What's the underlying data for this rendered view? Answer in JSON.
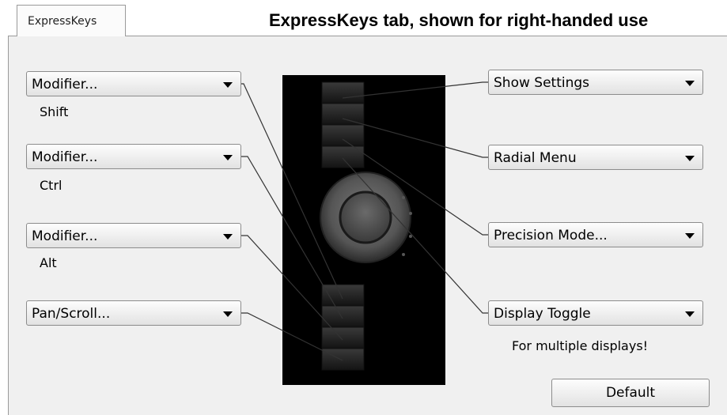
{
  "tab": {
    "label": "ExpressKeys"
  },
  "caption": "ExpressKeys tab, shown for right-handed use",
  "left_keys": [
    {
      "label": "Modifier...",
      "sub": "Shift"
    },
    {
      "label": "Modifier...",
      "sub": "Ctrl"
    },
    {
      "label": "Modifier...",
      "sub": "Alt"
    },
    {
      "label": "Pan/Scroll...",
      "sub": ""
    }
  ],
  "right_keys": [
    {
      "label": "Show Settings",
      "sub": ""
    },
    {
      "label": "Radial Menu",
      "sub": ""
    },
    {
      "label": "Precision Mode...",
      "sub": ""
    },
    {
      "label": "Display Toggle",
      "sub": "For multiple displays!"
    }
  ],
  "default_button": "Default",
  "colors": {
    "panel": "#f0f0f0",
    "device": "#000000",
    "leader_line": "#333333"
  }
}
